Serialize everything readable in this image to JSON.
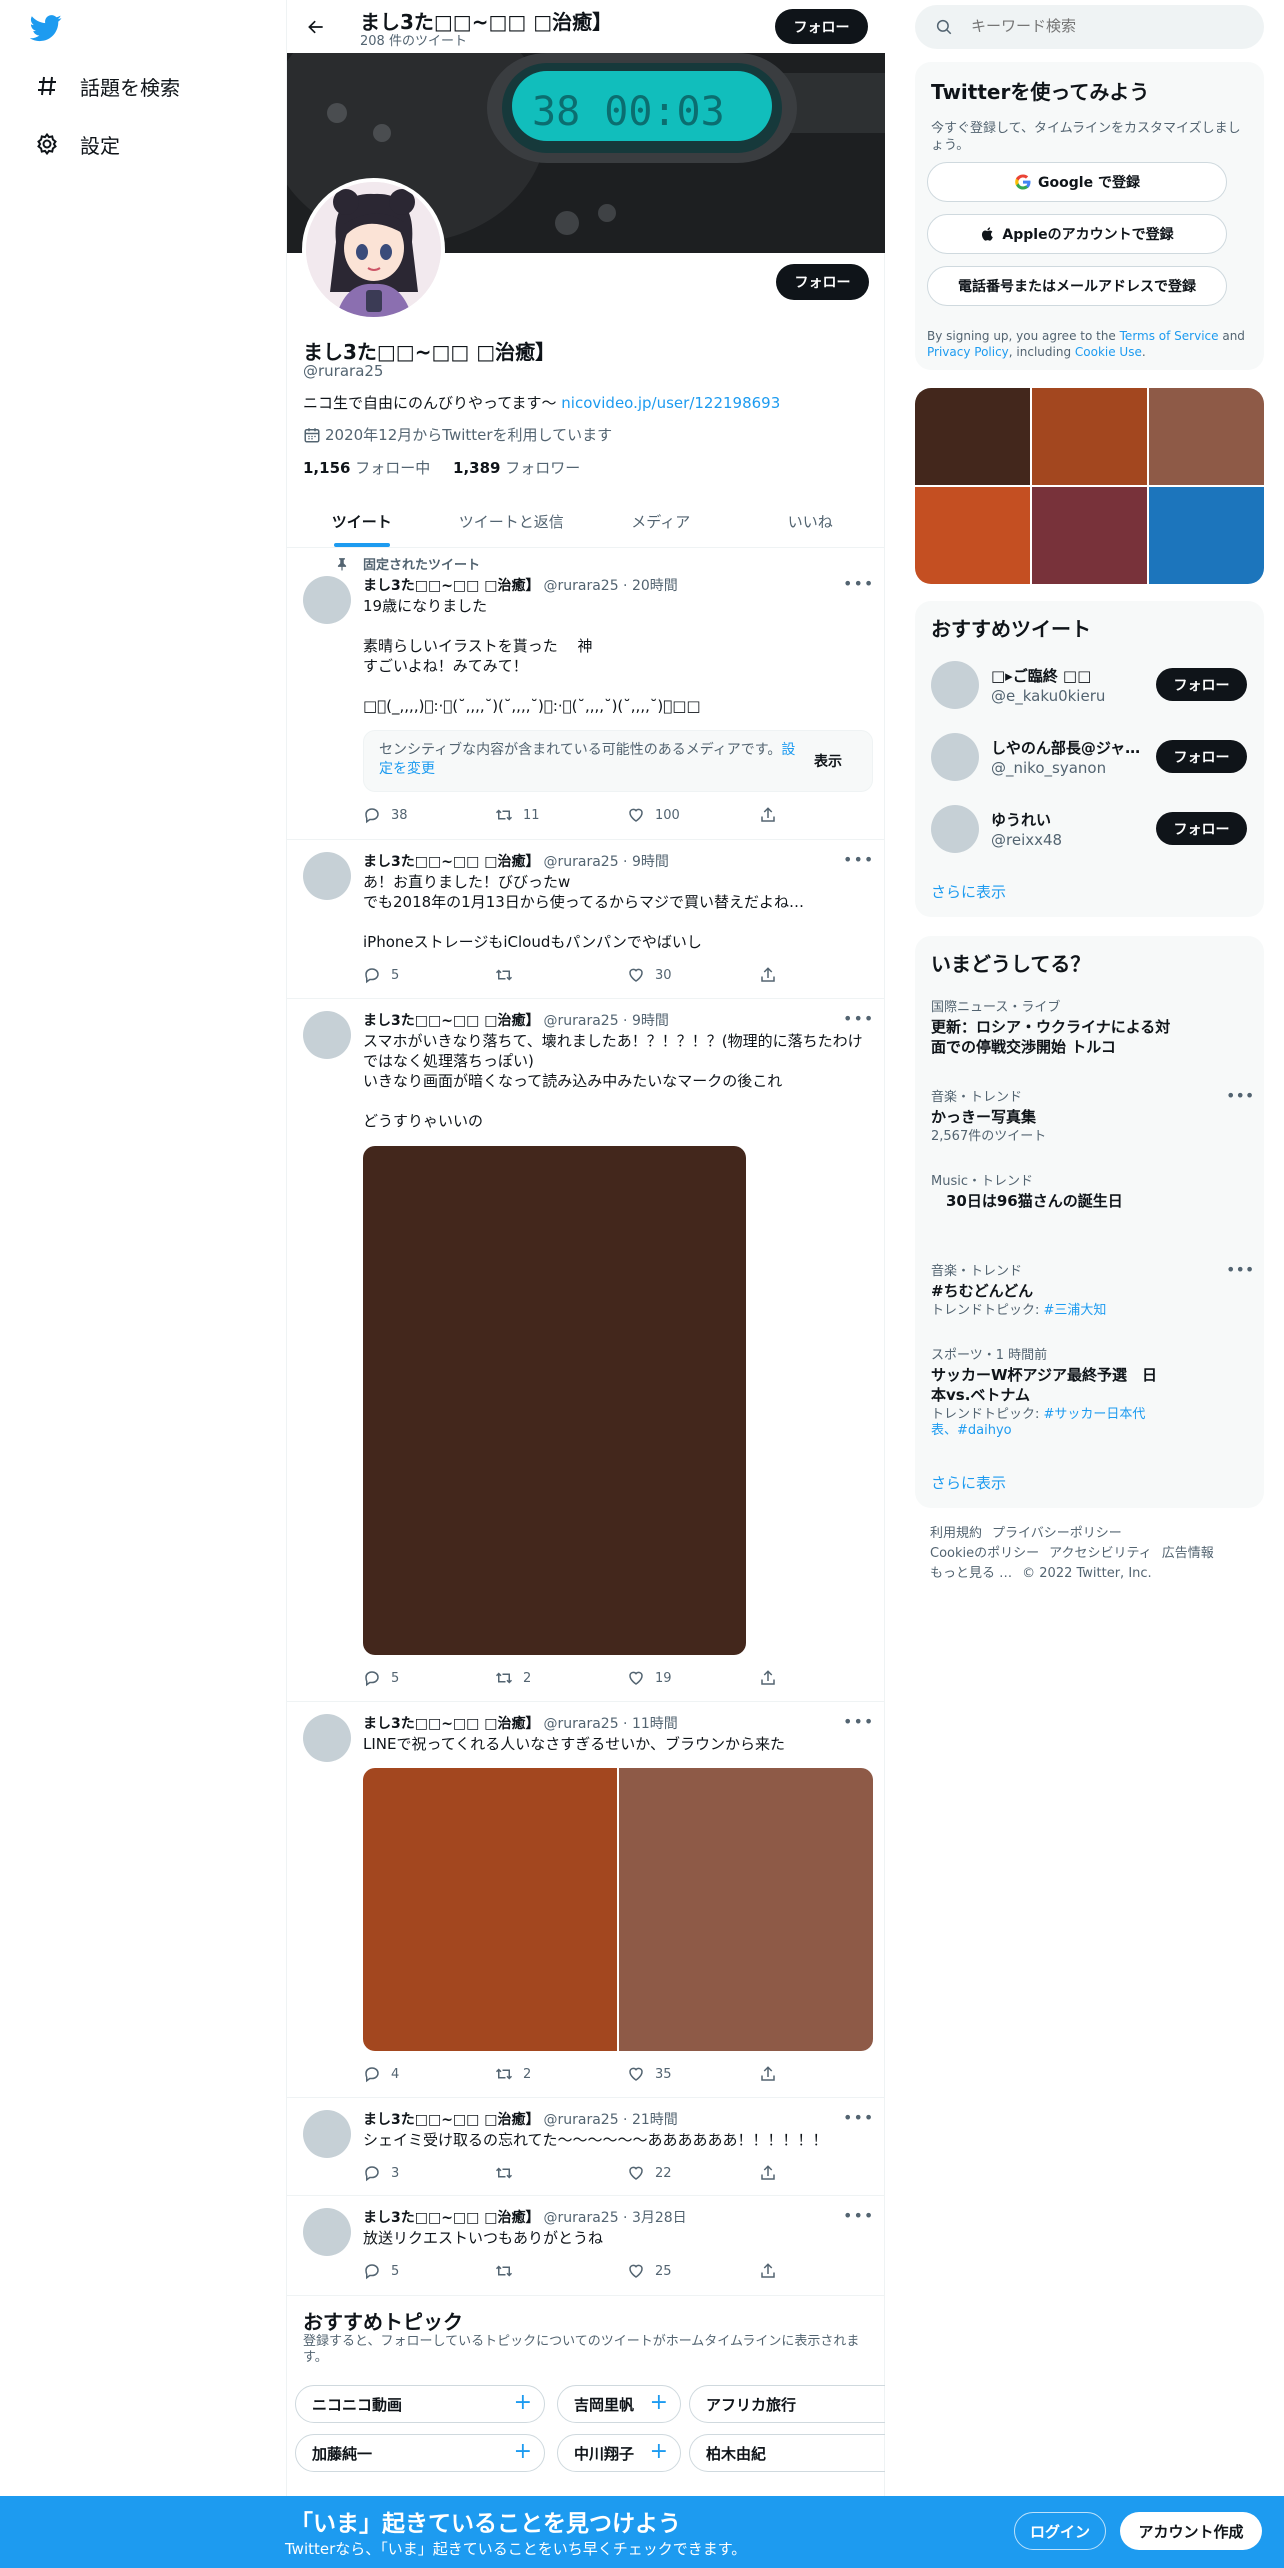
{
  "nav": {
    "explore_label": "話題を検索",
    "settings_label": "設定"
  },
  "header": {
    "title": "まし3た□□~□□ □治癒】",
    "tweet_count": "208 件のツイート",
    "follow_label": "フォロー"
  },
  "banner": {
    "display_text": "38 00:03"
  },
  "profile": {
    "name": "まし3た□□~□□ □治癒】",
    "handle": "@rurara25",
    "bio": "ニコ生で自由にのんびりやってます〜 ",
    "bio_link": "nicovideo.jp/user/122198693",
    "joined": "2020年12月からTwitterを利用しています",
    "following_count": "1,156",
    "following_label": " フォロー中",
    "followers_count": "1,389",
    "followers_label": " フォロワー",
    "follow_label": "フォロー"
  },
  "tabs": [
    "ツイート",
    "ツイートと返信",
    "メディア",
    "いいね"
  ],
  "tweets": [
    {
      "pinned_label": "固定されたツイート",
      "name": "まし3た□□~□□ □治癒】",
      "meta": "@rurara25 · 20時間",
      "text": "19歳になりました\n\n素晴らしいイラストを貰った　 神\nすごいよね！みてみて！\n\n□ﾞ(_,,,,)ﾞ:·ﾞ(˘,,,,˘)(˘,,,,˘)ﾞ:·ﾞ(˘,,,,˘)(˘,,,,˘)ﾞ□□",
      "sensitive_msg": "センシティブな内容が含まれている可能性のあるメディアです。",
      "sensitive_link": "設定を変更",
      "sensitive_show": "表示",
      "replies": "38",
      "retweets": "11",
      "likes": "100"
    },
    {
      "name": "まし3た□□~□□ □治癒】",
      "meta": "@rurara25 · 9時間",
      "text": "あ！お直りました！びびったw\nでも2018年の1月13日から使ってるからマジで買い替えだよね…\n\niPhoneストレージもiCloudもパンパンでやばいし",
      "replies": "5",
      "retweets": "",
      "likes": "30"
    },
    {
      "name": "まし3た□□~□□ □治癒】",
      "meta": "@rurara25 · 9時間",
      "text": "スマホがいきなり落ちて、壊れましたあ！？！？！？(物理的に落ちたわけではなく処理落ちっぽい)\nいきなり画面が暗くなって読み込み中みたいなマークの後これ\n\nどうすりゃいいの",
      "replies": "5",
      "retweets": "2",
      "likes": "19"
    },
    {
      "name": "まし3た□□~□□ □治癒】",
      "meta": "@rurara25 · 11時間",
      "text": "LINEで祝ってくれる人いなさすぎるせいか、ブラウンから来た",
      "replies": "4",
      "retweets": "2",
      "likes": "35"
    },
    {
      "name": "まし3た□□~□□ □治癒】",
      "meta": "@rurara25 · 21時間",
      "text": "シェイミ受け取るの忘れてた〜〜〜〜〜〜ああああああ！！！！！！",
      "replies": "3",
      "retweets": "",
      "likes": "22"
    },
    {
      "name": "まし3た□□~□□ □治癒】",
      "meta": "@rurara25 · 3月28日",
      "text": "放送リクエストいつもありがとうね",
      "replies": "5",
      "retweets": "",
      "likes": "25"
    }
  ],
  "topics": {
    "title": "おすすめトピック",
    "subtitle": "登録すると、フォローしているトピックについてのツイートがホームタイムラインに表示されます。",
    "row1": [
      "ニコニコ動画",
      "吉岡里帆",
      "アフリカ旅行"
    ],
    "row2": [
      "加藤純一",
      "中川翔子",
      "柏木由紀"
    ]
  },
  "search": {
    "placeholder": "キーワード検索"
  },
  "signup": {
    "title": "Twitterを使ってみよう",
    "subtitle": "今すぐ登録して、タイムラインをカスタマイズしましょう。",
    "google": "Google で登録",
    "apple": "Appleのアカウントで登録",
    "phone": "電話番号またはメールアドレスで登録",
    "terms_prefix": "By signing up, you agree to the ",
    "terms_link": "Terms of Service",
    "terms_and": " and ",
    "privacy_link": "Privacy Policy",
    "terms_including": ", including ",
    "cookie_link": "Cookie Use",
    "terms_end": "."
  },
  "recommended": {
    "title": "おすすめツイート",
    "users": [
      {
        "name": "□▸ご臨終 □□",
        "handle": "@e_kaku0kieru"
      },
      {
        "name": "しやのん部長@ジャ…",
        "handle": "@_niko_syanon"
      },
      {
        "name": "ゆうれい",
        "handle": "@reixx48"
      }
    ],
    "follow_label": "フォロー",
    "more": "さらに表示"
  },
  "trends": {
    "title": "いまどうしてる？",
    "items": [
      {
        "category": "国際ニュース・ライブ",
        "title": "更新：ロシア・ウクライナによる対面での停戦交渉開始 トルコ",
        "sub": ""
      },
      {
        "category": "音楽・トレンド",
        "title": "かっきー写真集",
        "sub": "2,567件のツイート"
      },
      {
        "category": "Music・トレンド",
        "title": "　30日は96猫さんの誕生日",
        "sub": ""
      },
      {
        "category": "音楽・トレンド",
        "title": "#ちむどんどん",
        "sub_prefix": "トレンドトピック: ",
        "sub_link": "#三浦大知"
      },
      {
        "category": "スポーツ・1 時間前",
        "title": "サッカーW杯アジア最終予選　日本vs.ベトナム",
        "sub_prefix": "トレンドトピック: ",
        "sub_link": "#サッカー日本代表、#daihyo"
      }
    ],
    "more": "さらに表示"
  },
  "footer": {
    "links": [
      "利用規約",
      "プライバシーポリシー",
      "Cookieのポリシー",
      "アクセシビリティ",
      "広告情報",
      "もっと見る …",
      "© 2022 Twitter, Inc."
    ]
  },
  "bottombar": {
    "title": "「いま」起きていることを見つけよう",
    "subtitle": "Twitterなら、「いま」起きていることをいち早くチェックできます。",
    "login": "ログイン",
    "signup": "アカウント作成"
  },
  "colors": {
    "accent": "#1d9bf0",
    "media_1": "#43271c",
    "media_2": "#a3471f",
    "media_3": "#8e5a47",
    "grid": [
      "#43271c",
      "#a3471f",
      "#8e5a47",
      "#c44f22",
      "#78323a",
      "#1c75bc"
    ]
  }
}
